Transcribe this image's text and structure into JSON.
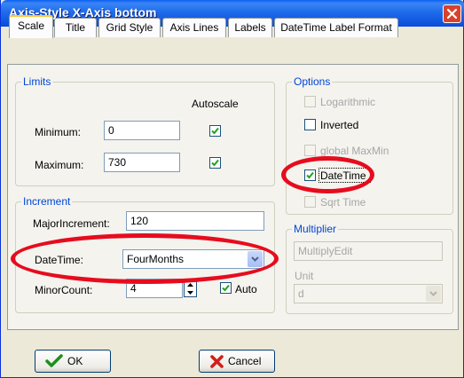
{
  "window": {
    "title": "Axis-Style X-Axis bottom"
  },
  "tabs": [
    {
      "label": "Scale",
      "active": true
    },
    {
      "label": "Title",
      "active": false
    },
    {
      "label": "Grid Style",
      "active": false
    },
    {
      "label": "Axis Lines",
      "active": false
    },
    {
      "label": "Labels",
      "active": false
    },
    {
      "label": "DateTime Label Format",
      "active": false
    }
  ],
  "limits": {
    "legend": "Limits",
    "autoscale_header": "Autoscale",
    "minimum_label": "Minimum:",
    "minimum_value": "0",
    "minimum_autoscale": true,
    "maximum_label": "Maximum:",
    "maximum_value": "730",
    "maximum_autoscale": true
  },
  "increment": {
    "legend": "Increment",
    "major_label": "MajorIncrement:",
    "major_value": "120",
    "datetime_label": "DateTime:",
    "datetime_value": "FourMonths",
    "minor_label": "MinorCount:",
    "minor_value": "4",
    "auto_label": "Auto",
    "auto_checked": true
  },
  "options": {
    "legend": "Options",
    "items": [
      {
        "label": "Logarithmic",
        "checked": false,
        "enabled": false
      },
      {
        "label": "Inverted",
        "checked": false,
        "enabled": true
      },
      {
        "label": "global MaxMin",
        "checked": false,
        "enabled": false
      },
      {
        "label": "DateTime",
        "checked": true,
        "enabled": true
      },
      {
        "label": "Sqrt Time",
        "checked": false,
        "enabled": false
      }
    ]
  },
  "multiplier": {
    "legend": "Multiplier",
    "edit_value": "MultiplyEdit",
    "unit_label": "Unit",
    "unit_value": "d"
  },
  "buttons": {
    "ok_label": "OK",
    "cancel_label": "Cancel"
  },
  "colors": {
    "annotation": "#E60C1E",
    "titlebar": "#0B4BD8",
    "check": "#21A121",
    "cancel_x": "#D0201B"
  }
}
